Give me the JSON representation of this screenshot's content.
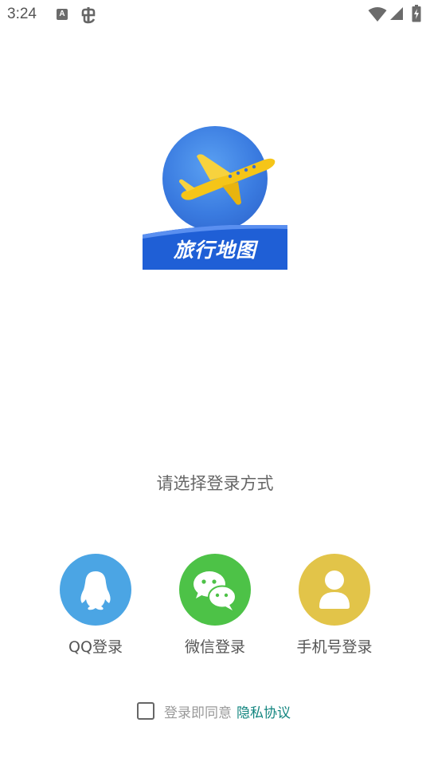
{
  "status_bar": {
    "time": "3:24",
    "a_badge": "A",
    "icons": [
      "a-notification-icon",
      "bug-icon",
      "wifi-icon",
      "cell-signal-icon",
      "battery-charging-icon"
    ]
  },
  "logo": {
    "text": "旅行地图",
    "colors": {
      "globe": "#3a7be0",
      "plane": "#f5c518",
      "banner": "#1f5fd6"
    }
  },
  "prompt": "请选择登录方式",
  "login_options": [
    {
      "label": "QQ登录",
      "icon": "qq-icon",
      "color": "#4ba5e4"
    },
    {
      "label": "微信登录",
      "icon": "wechat-icon",
      "color": "#4dc247"
    },
    {
      "label": "手机号登录",
      "icon": "user-icon",
      "color": "#e2c449"
    }
  ],
  "agreement": {
    "checked": false,
    "text": "登录即同意",
    "link": "隐私协议",
    "link_color": "#12857f"
  }
}
